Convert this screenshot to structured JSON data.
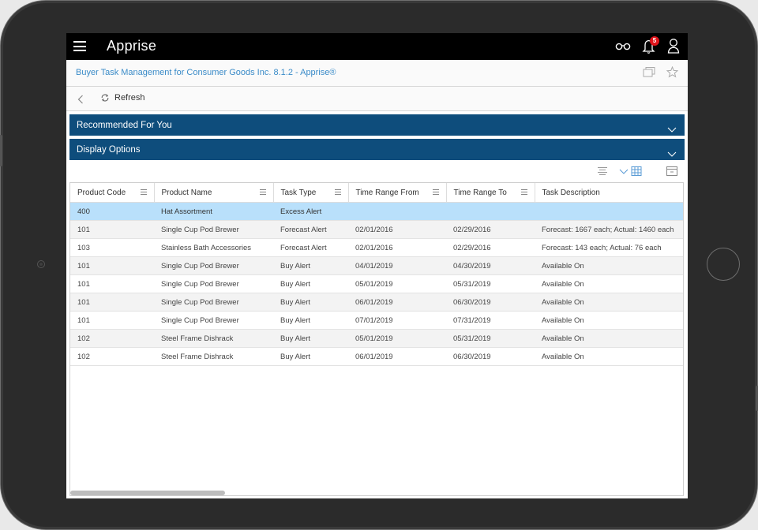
{
  "app": {
    "title": "Apprise",
    "notification_count": "5"
  },
  "page": {
    "title": "Buyer Task Management for Consumer Goods Inc. 8.1.2 - Apprise®"
  },
  "toolbar": {
    "refresh_label": "Refresh"
  },
  "panels": {
    "recommended": "Recommended For You",
    "display_options": "Display Options"
  },
  "table": {
    "columns": [
      "Product Code",
      "Product Name",
      "Task Type",
      "Time Range From",
      "Time Range To",
      "Task Description"
    ],
    "rows": [
      [
        "400",
        "Hat Assortment",
        "Excess Alert",
        "",
        "",
        ""
      ],
      [
        "101",
        "Single Cup Pod Brewer",
        "Forecast Alert",
        "02/01/2016",
        "02/29/2016",
        "Forecast: 1667 each; Actual: 1460 each"
      ],
      [
        "103",
        "Stainless Bath Accessories",
        "Forecast Alert",
        "02/01/2016",
        "02/29/2016",
        "Forecast: 143 each; Actual: 76 each"
      ],
      [
        "101",
        "Single Cup Pod Brewer",
        "Buy Alert",
        "04/01/2019",
        "04/30/2019",
        "Available On"
      ],
      [
        "101",
        "Single Cup Pod Brewer",
        "Buy Alert",
        "05/01/2019",
        "05/31/2019",
        "Available On"
      ],
      [
        "101",
        "Single Cup Pod Brewer",
        "Buy Alert",
        "06/01/2019",
        "06/30/2019",
        "Available On"
      ],
      [
        "101",
        "Single Cup Pod Brewer",
        "Buy Alert",
        "07/01/2019",
        "07/31/2019",
        "Available On"
      ],
      [
        "102",
        "Steel Frame Dishrack",
        "Buy Alert",
        "05/01/2019",
        "05/31/2019",
        "Available On"
      ],
      [
        "102",
        "Steel Frame Dishrack",
        "Buy Alert",
        "06/01/2019",
        "06/30/2019",
        "Available On"
      ]
    ],
    "selected_row": 0
  },
  "colors": {
    "header_bar": "#0e4d7c",
    "selected_row": "#b9e0fb",
    "link": "#3a8bc8"
  }
}
